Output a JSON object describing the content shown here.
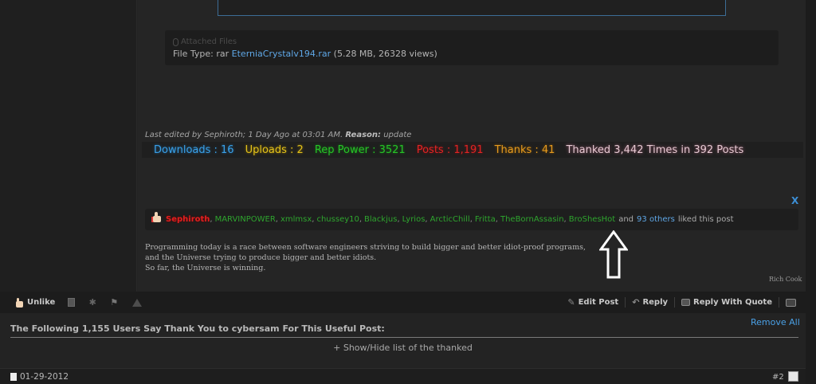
{
  "attachment": {
    "legend": "Attached Files",
    "file_type_label": "File Type: rar",
    "file_name": "EterniaCrystalv194.rar",
    "file_meta": "(5.28 MB, 26328 views)"
  },
  "edited": {
    "prefix": "Last edited by Sephiroth; 1 Day Ago at 03:01 AM.",
    "reason_label": "Reason:",
    "reason": "update"
  },
  "stats": {
    "downloads": "Downloads : 16",
    "uploads": "Uploads : 2",
    "rep_power": "Rep Power : 3521",
    "posts": "Posts : 1,191",
    "thanks": "Thanks : 41",
    "thanked": "Thanked 3,442 Times in 392 Posts"
  },
  "close_label": "X",
  "likes": {
    "users": [
      "Sephiroth",
      "MARVINPOWER",
      "xmlmsx",
      "chussey10",
      "Blackjus",
      "Lyrios",
      "ArcticChill",
      "Fritta",
      "TheBornAssasin",
      "BroShesHot"
    ],
    "and_text": "and",
    "others_link": "93 others",
    "liked_text": "liked this post"
  },
  "signature": {
    "lines": [
      "Programming today is a race between software engineers striving to build bigger and better idiot-proof programs,",
      "and the Universe trying to produce bigger and better idiots.",
      "So far, the Universe is winning."
    ],
    "author": "Rich Cook"
  },
  "toolbar": {
    "unlike": "Unlike",
    "edit_post": "Edit Post",
    "reply": "Reply",
    "reply_with_quote": "Reply With Quote",
    "icons": [
      "thumb-hand-icon",
      "document-icon",
      "star-icon",
      "flag-icon",
      "warning-icon",
      "pencil-icon",
      "reply-arrow-icon",
      "quote-bubble-icon",
      "multi-quote-icon"
    ]
  },
  "thanks_section": {
    "title": "The Following 1,155 Users Say Thank You to cybersam For This Useful Post:",
    "remove_all": "Remove All",
    "show_hide": "+ Show/Hide list of the thanked"
  },
  "next_post": {
    "date": "01-29-2012",
    "number": "#2"
  },
  "colors": {
    "link": "#5fa7e6",
    "downloads": "#3aa0e8",
    "uploads": "#e2c11b",
    "rep_power": "#27c327",
    "posts": "#e02424",
    "thanks": "#e59a1f",
    "liker": "#2ea52e"
  }
}
